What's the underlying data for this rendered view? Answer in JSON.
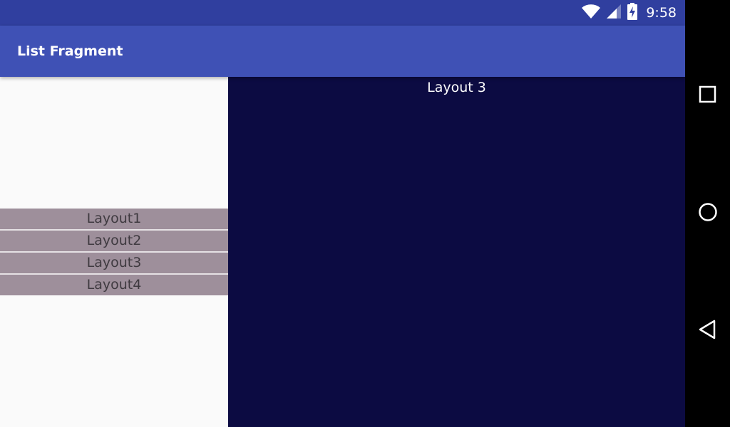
{
  "status_bar": {
    "time": "9:58",
    "icons": [
      "wifi-icon",
      "cell-signal-icon",
      "battery-charging-icon"
    ]
  },
  "app_bar": {
    "title": "List Fragment"
  },
  "list": {
    "items": [
      {
        "label": "Layout1"
      },
      {
        "label": "Layout2"
      },
      {
        "label": "Layout3"
      },
      {
        "label": "Layout4"
      }
    ]
  },
  "content": {
    "title": "Layout 3"
  },
  "nav_bar": {
    "buttons": [
      "recents-icon",
      "home-icon",
      "back-icon"
    ]
  },
  "colors": {
    "status_bar": "#303f9f",
    "app_bar": "#3f51b5",
    "list_item_bg": "#9e8f9b",
    "content_bg": "#0c0b42",
    "nav_bar": "#000000"
  }
}
